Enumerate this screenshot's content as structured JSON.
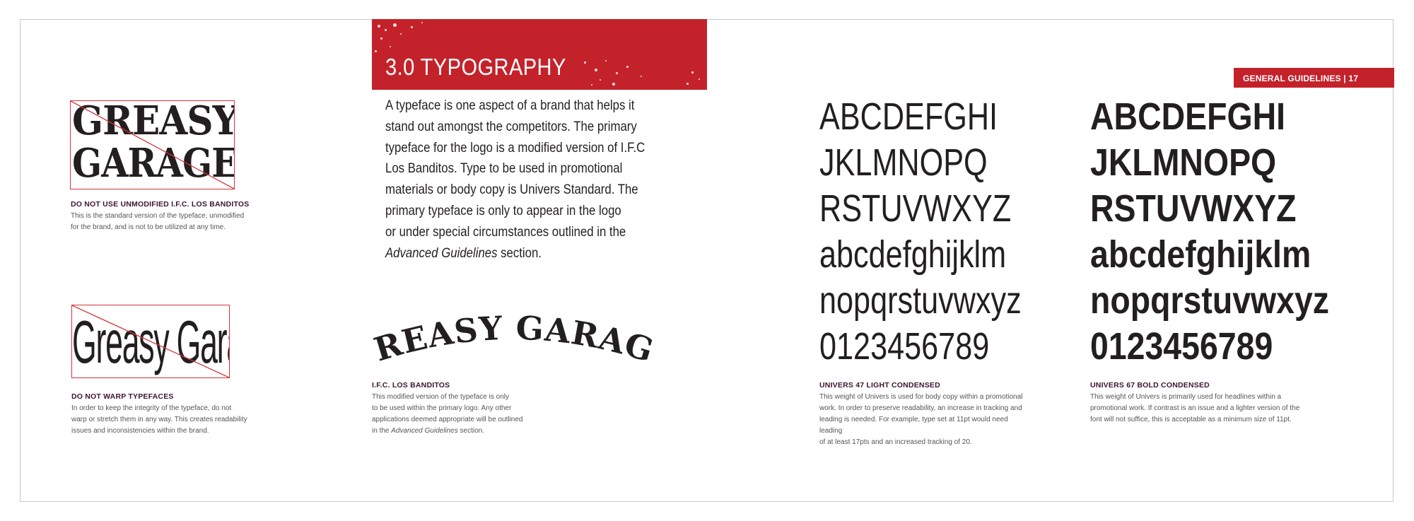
{
  "header": {
    "section_title": "3.0 TYPOGRAPHY",
    "page_tab": "GENERAL GUIDELINES | 17"
  },
  "examples": {
    "unmodified": {
      "logo_line1": "GREASY",
      "logo_line2": "GARAGE",
      "heading": "DO NOT USE UNMODIFIED I.F.C. LOS BANDITOS",
      "body": [
        "This is the standard version of the typeface, unmodified",
        "for the brand, and is not to be utilized at any time."
      ]
    },
    "warped": {
      "logo_text": "Greasy Garage",
      "heading": "DO NOT WARP TYPEFACES",
      "body": [
        "In order to keep the integrity of the typeface, do not",
        "warp or stretch them in any way. This creates readability",
        "issues and inconsistencies within the brand."
      ]
    }
  },
  "intro": {
    "lines": [
      "A typeface is one aspect of a brand that helps it",
      "stand out amongst the competitors. The primary",
      "typeface for the logo is a modified version of I.F.C",
      "Los Banditos. Type to be used in promotional",
      "materials or body copy is Univers Standard. The",
      "primary typeface is only to appear in the logo",
      "or under special circumstances outlined in the"
    ],
    "last_italic": "Advanced Guidelines",
    "last_rest": " section."
  },
  "primary_logo": {
    "text": "GREASY GARAGE",
    "heading": "I.F.C. LOS BANDITOS",
    "body": [
      "This modified version of the typeface is only",
      "to be used within the primary logo. Any other",
      "applications deemed appropriate will be outlined"
    ],
    "last_prefix": "in the ",
    "last_italic": "Advanced Guidelines",
    "last_rest": " section."
  },
  "light_specimen": {
    "lines": [
      "ABCDEFGHI",
      "JKLMNOPQ",
      "RSTUVWXYZ",
      "abcdefghijklm",
      "nopqrstuvwxyz",
      "0123456789"
    ],
    "heading": "UNIVERS 47 LIGHT CONDENSED",
    "body": [
      "This weight of Univers is used for body copy within a promotional",
      "work. In order to preserve readability, an increase in tracking and",
      "leading is needed. For example, type set at 11pt would need leading",
      "of at least 17pts and an increased tracking of 20."
    ]
  },
  "bold_specimen": {
    "lines": [
      "ABCDEFGHI",
      "JKLMNOPQ",
      "RSTUVWXYZ",
      "abcdefghijklm",
      "nopqrstuvwxyz",
      "0123456789"
    ],
    "heading": "UNIVERS 67 BOLD CONDENSED",
    "body": [
      "This weight of Univers is primarily used for headlines within a",
      "promotional work. If contrast is an issue and a lighter version of the",
      "font will not suffice, this is acceptable as a minimum size of 11pt."
    ]
  },
  "colors": {
    "brand_red": "#c4222b",
    "caption_heading": "#3d1530"
  }
}
